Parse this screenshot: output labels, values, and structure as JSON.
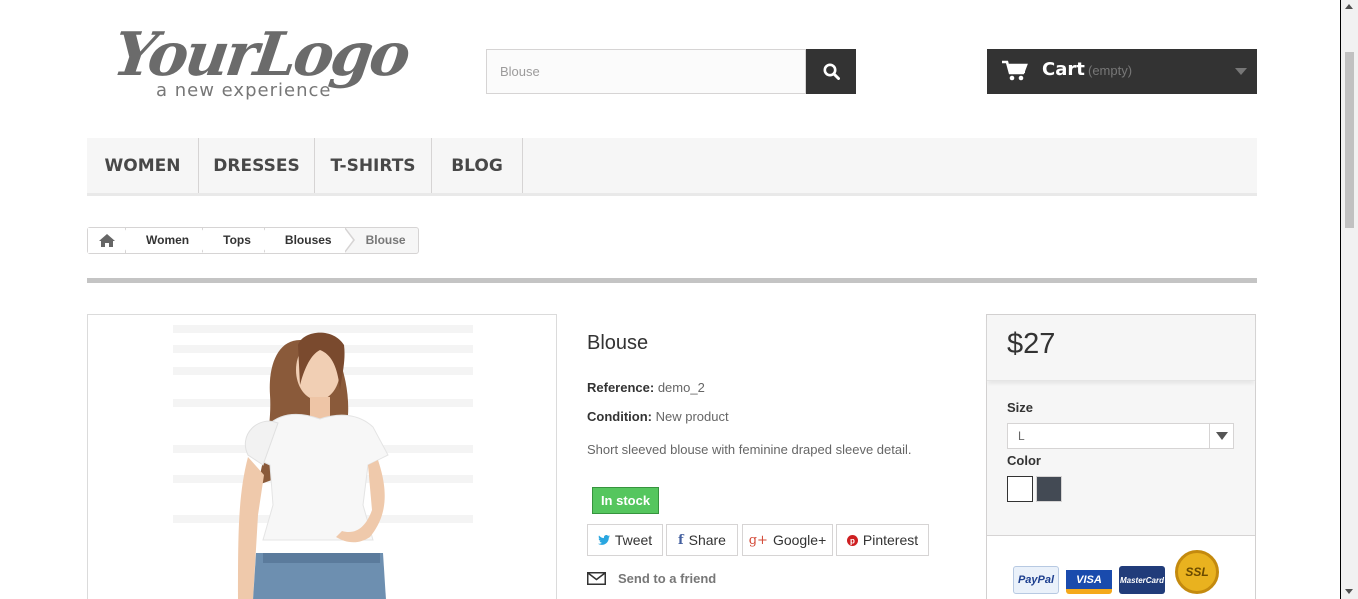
{
  "logo": {
    "main": "YourLogo",
    "tagline": "a new experience"
  },
  "search": {
    "placeholder": "Blouse"
  },
  "cart": {
    "label": "Cart",
    "status": "(empty)"
  },
  "nav": {
    "items": [
      "WOMEN",
      "DRESSES",
      "T-SHIRTS",
      "BLOG"
    ]
  },
  "breadcrumb": {
    "items": [
      "Women",
      "Tops",
      "Blouses"
    ],
    "current": "Blouse"
  },
  "product": {
    "name": "Blouse",
    "reference_label": "Reference:",
    "reference_value": "demo_2",
    "condition_label": "Condition:",
    "condition_value": "New product",
    "description": "Short sleeved blouse with feminine draped sleeve detail.",
    "stock": "In stock",
    "send_friend": "Send to a friend"
  },
  "social": {
    "tweet": "Tweet",
    "share": "Share",
    "google": "Google+",
    "pinterest": "Pinterest"
  },
  "price_box": {
    "price": "$27",
    "size_label": "Size",
    "size_value": "L",
    "color_label": "Color",
    "colors": [
      "#ffffff",
      "#434a54"
    ]
  },
  "payments": {
    "paypal": "PayPal",
    "visa": "VISA",
    "mastercard": "MasterCard",
    "ssl": "SSL"
  },
  "colors": {
    "dark": "#333333",
    "stock_green": "#55c65e",
    "nav_bg": "#f6f6f6"
  }
}
